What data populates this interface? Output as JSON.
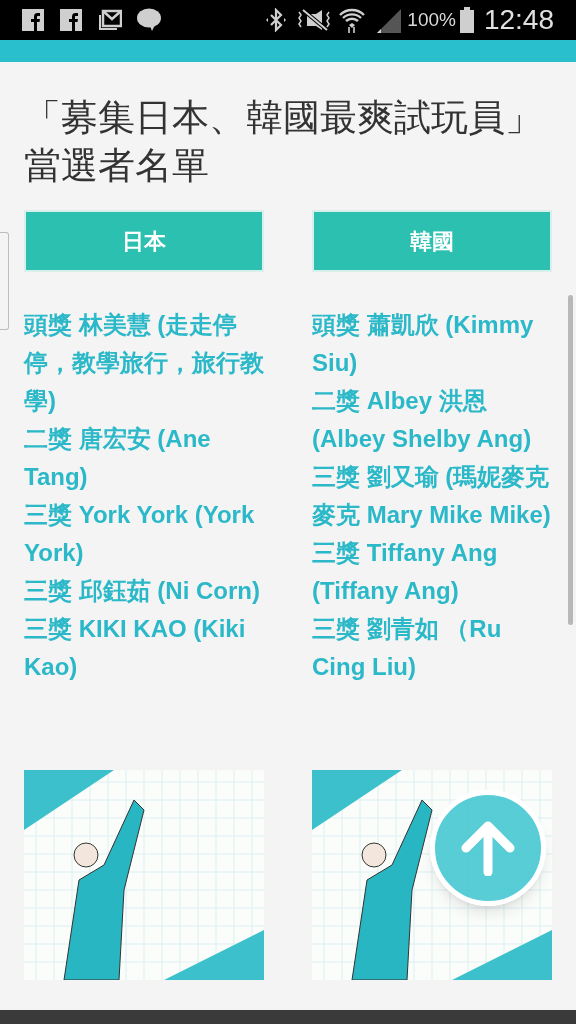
{
  "status_bar": {
    "battery": "100%",
    "time": "12:48"
  },
  "title": "「募集日本、韓國最爽試玩員」當選者名單",
  "columns": [
    {
      "tab": "日本",
      "winners": [
        "頭獎 林美慧 (走走停停，教學旅行，旅行教學)",
        "二獎 唐宏安 (Ane Tang)",
        "三獎 York York (York York)",
        "三獎 邱鈺茹 (Ni Corn)",
        "三獎 KIKI KAO (Kiki Kao)"
      ]
    },
    {
      "tab": "韓國",
      "winners": [
        "頭獎 蕭凱欣 (Kimmy Siu)",
        "二獎 Albey 洪恩 (Albey Shelby Ang)",
        "三獎 劉又瑜 (瑪妮麥克麥克 Mary Mike Mike)",
        "三獎 Tiffany Ang (Tiffany Ang)",
        "三獎 劉青如 （Ru Cing Liu)"
      ]
    }
  ]
}
